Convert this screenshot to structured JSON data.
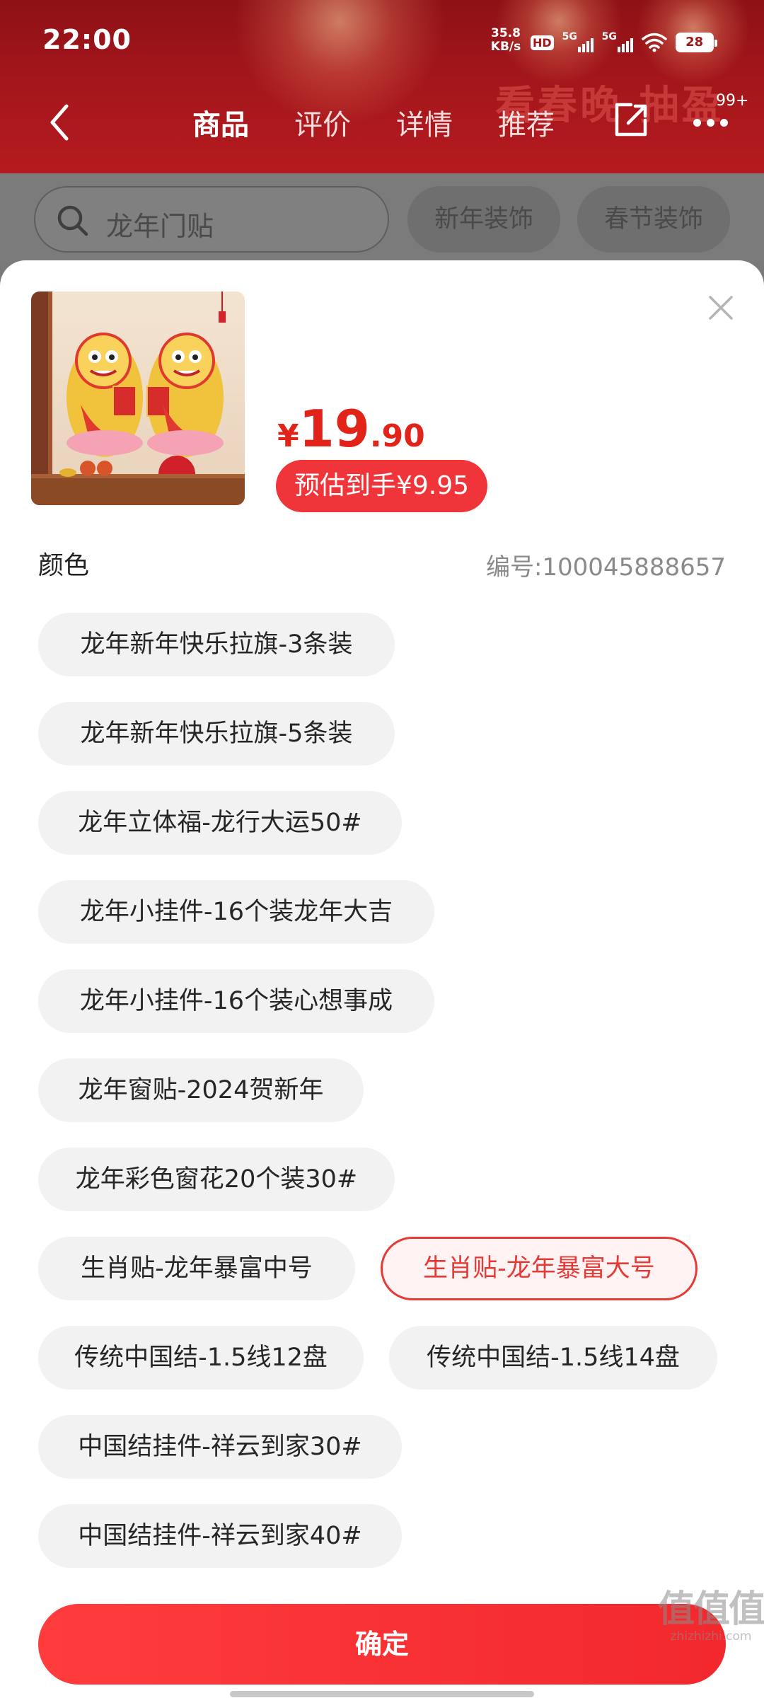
{
  "status_bar": {
    "time": "22:00",
    "net_speed_value": "35.8",
    "net_speed_unit": "KB/s",
    "hd_label": "HD",
    "signal1_label": "5G",
    "signal2_label": "5G",
    "battery": "28"
  },
  "nav": {
    "tabs": [
      {
        "label": "商品",
        "active": true
      },
      {
        "label": "评价",
        "active": false
      },
      {
        "label": "详情",
        "active": false
      },
      {
        "label": "推荐",
        "active": false
      }
    ],
    "decor_text": "看春晚 抽盈",
    "more_badge": "99+"
  },
  "search": {
    "query": "龙年门贴",
    "chips": [
      "新年装饰",
      "春节装饰"
    ]
  },
  "product": {
    "price_symbol": "¥",
    "price_integer": "19",
    "price_decimal": ".90",
    "estimate_label": "预估到手¥9.95"
  },
  "spec": {
    "section_title": "颜色",
    "sku_label": "编号:100045888657",
    "options": [
      {
        "label": "龙年新年快乐拉旗-3条装",
        "selected": false
      },
      {
        "label": "龙年新年快乐拉旗-5条装",
        "selected": false
      },
      {
        "label": "龙年立体福-龙行大运50#",
        "selected": false
      },
      {
        "label": "龙年小挂件-16个装龙年大吉",
        "selected": false
      },
      {
        "label": "龙年小挂件-16个装心想事成",
        "selected": false
      },
      {
        "label": "龙年窗贴-2024贺新年",
        "selected": false
      },
      {
        "label": "龙年彩色窗花20个装30#",
        "selected": false
      },
      {
        "label": "生肖贴-龙年暴富中号",
        "selected": false
      },
      {
        "label": "生肖贴-龙年暴富大号",
        "selected": true
      },
      {
        "label": "传统中国结-1.5线12盘",
        "selected": false
      },
      {
        "label": "传统中国结-1.5线14盘",
        "selected": false
      },
      {
        "label": "中国结挂件-祥云到家30#",
        "selected": false
      },
      {
        "label": "中国结挂件-祥云到家40#",
        "selected": false
      }
    ]
  },
  "confirm_label": "确定",
  "watermark": {
    "logo": "值值值",
    "url": "zhizhizhi.com"
  },
  "colors": {
    "accent": "#e2231a",
    "header": "#a3161b",
    "selected_border": "#e53a36"
  }
}
